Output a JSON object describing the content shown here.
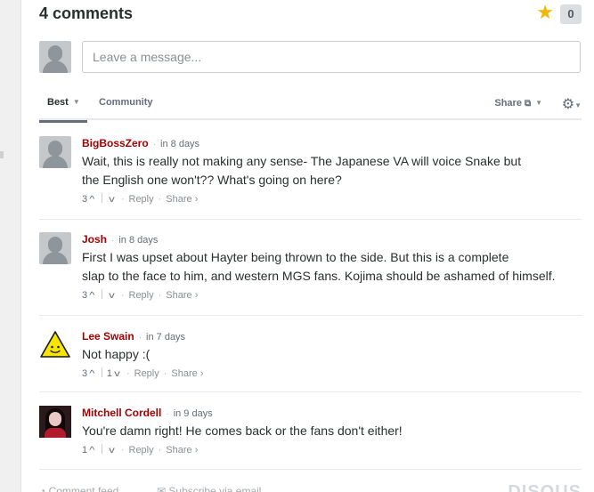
{
  "header": {
    "comment_count": "4 comments",
    "star_count": "0"
  },
  "composer": {
    "placeholder": "Leave a message..."
  },
  "nav": {
    "tab_best": "Best",
    "tab_community": "Community",
    "share": "Share",
    "gear_icon": "gear-icon"
  },
  "posts": [
    {
      "author": "BigBossZero",
      "time": "in 8 days",
      "text_line1": "Wait, this is really not making any sense- The Japanese VA will voice Snake but",
      "text_line2": "the English one won't?? What's going on here?",
      "upvotes": "3",
      "downvotes": "",
      "reply": "Reply",
      "share": "Share ›",
      "avatar": "default-avatar"
    },
    {
      "author": "Josh",
      "time": "in 8 days",
      "text_line1": "First I was upset about Hayter being thrown to the side. But this is a complete",
      "text_line2": "slap to the face to him, and western MGS fans. Kojima should be ashamed of himself.",
      "upvotes": "3",
      "downvotes": "",
      "reply": "Reply",
      "share": "Share ›",
      "avatar": "default-avatar"
    },
    {
      "author": "Lee Swain",
      "time": "in 7 days",
      "text_line1": "Not happy :(",
      "upvotes": "3",
      "downvotes": "1",
      "reply": "Reply",
      "share": "Share ›",
      "avatar": "warning-smiley-avatar"
    },
    {
      "author": "Mitchell Cordell",
      "time": "in 9 days",
      "text_line1": "You're damn right! He comes back or the fans don't either!",
      "upvotes": "1",
      "downvotes": "",
      "reply": "Reply",
      "share": "Share ›",
      "avatar": "photo-avatar"
    }
  ],
  "footer": {
    "comment_feed": "Comment feed",
    "subscribe": "Subscribe via email",
    "brand": "DISQUS"
  },
  "colors": {
    "author": "#a80000",
    "star": "#f2b705",
    "text": "#2a2e2e",
    "muted": "#656c7a"
  }
}
